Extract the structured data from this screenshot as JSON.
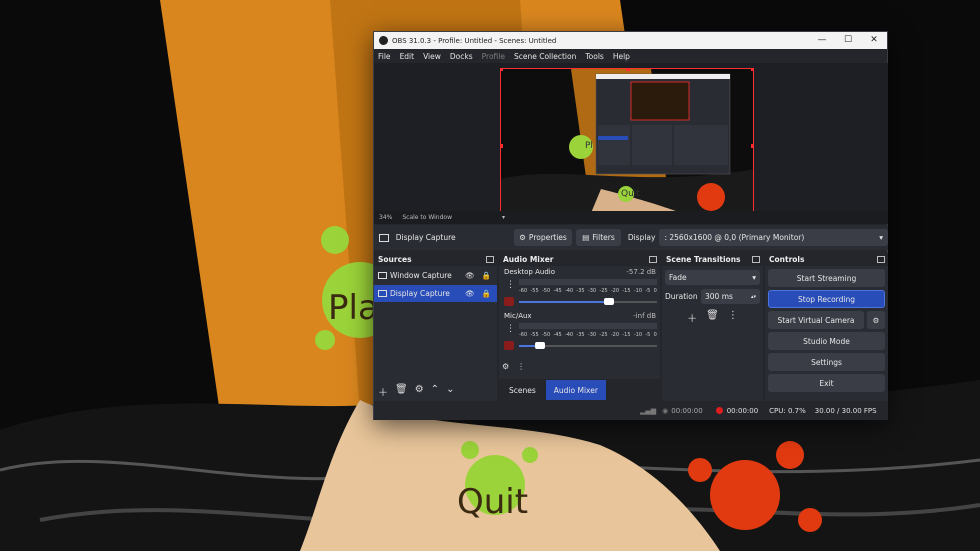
{
  "background": {
    "play_label": "Pla",
    "quit_label": "Quit",
    "colors": {
      "cone": "#d9861e",
      "splat": "#9bd33a",
      "red": "#e23a10"
    }
  },
  "window": {
    "title": "OBS 31.0.3 - Profile: Untitled - Scenes: Untitled",
    "controls": [
      "—",
      "☐",
      "✕"
    ]
  },
  "menu": [
    "File",
    "Edit",
    "View",
    "Docks",
    "Profile",
    "Scene Collection",
    "Tools",
    "Help"
  ],
  "preview": {
    "zoom": "34%",
    "scale_mode": "Scale to Window",
    "inner_quit": "Quit",
    "inner_play": "Pl"
  },
  "source_bar": {
    "source_name": "Display Capture",
    "properties_label": "Properties",
    "filters_label": "Filters",
    "display_label": "Display",
    "display_value": ": 2560x1600 @ 0,0 (Primary Monitor)"
  },
  "sources": {
    "title": "Sources",
    "items": [
      {
        "label": "Window Capture",
        "selected": false
      },
      {
        "label": "Display Capture",
        "selected": true
      }
    ]
  },
  "audio_mixer": {
    "title": "Audio Mixer",
    "channels": [
      {
        "name": "Desktop Audio",
        "level": "-57.2 dB",
        "volume": 0.65
      },
      {
        "name": "Mic/Aux",
        "level": "-inf dB",
        "volume": 0.15
      }
    ],
    "ticks": [
      "-60",
      "-55",
      "-50",
      "-45",
      "-40",
      "-35",
      "-30",
      "-25",
      "-20",
      "-15",
      "-10",
      "-5",
      "0"
    ]
  },
  "dock_tabs": {
    "scenes": "Scenes",
    "audio_mixer": "Audio Mixer"
  },
  "scene_transitions": {
    "title": "Scene Transitions",
    "transition": "Fade",
    "duration_label": "Duration",
    "duration_value": "300 ms"
  },
  "controls": {
    "title": "Controls",
    "start_streaming": "Start Streaming",
    "stop_recording": "Stop Recording",
    "start_virtual_camera": "Start Virtual Camera",
    "studio_mode": "Studio Mode",
    "settings": "Settings",
    "exit": "Exit"
  },
  "status": {
    "stream_time": "00:00:00",
    "record_time": "00:00:00",
    "cpu": "CPU: 0.7%",
    "fps": "30.00 / 30.00 FPS"
  }
}
